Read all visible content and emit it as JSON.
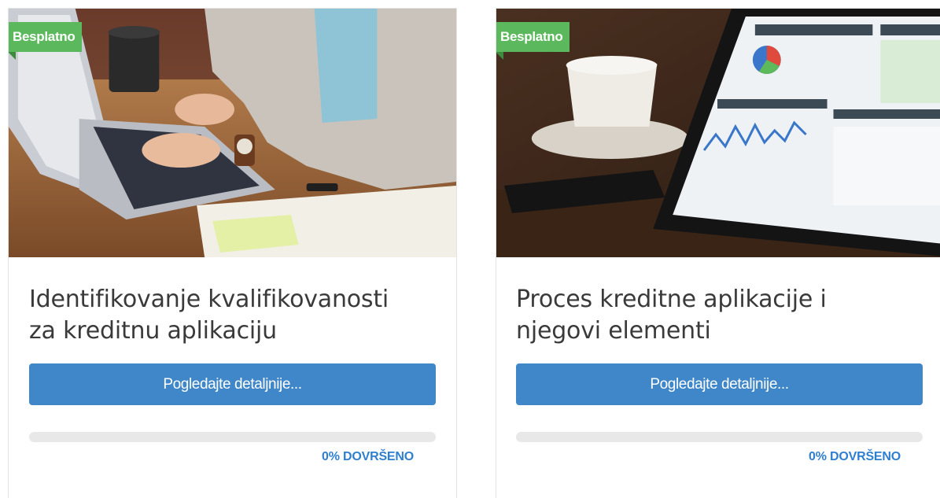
{
  "courses": [
    {
      "badge": "Besplatno",
      "title_line1": "Identifikovanje kvalifikovanosti",
      "title_line2": "za kreditnu aplikaciju",
      "button_label": "Pogledajte detaljnije...",
      "progress_percent": 0,
      "progress_label": "0% DOVRŠENO"
    },
    {
      "badge": "Besplatno",
      "title_line1": "Proces kreditne aplikacije i",
      "title_line2": "njegovi elementi",
      "button_label": "Pogledajte detaljnije...",
      "progress_percent": 0,
      "progress_label": "0% DOVRŠENO"
    }
  ],
  "colors": {
    "badge": "#5cb85c",
    "button": "#3f87c9",
    "progress_label": "#2f7fd0",
    "progress_track": "#e8e8e8"
  }
}
